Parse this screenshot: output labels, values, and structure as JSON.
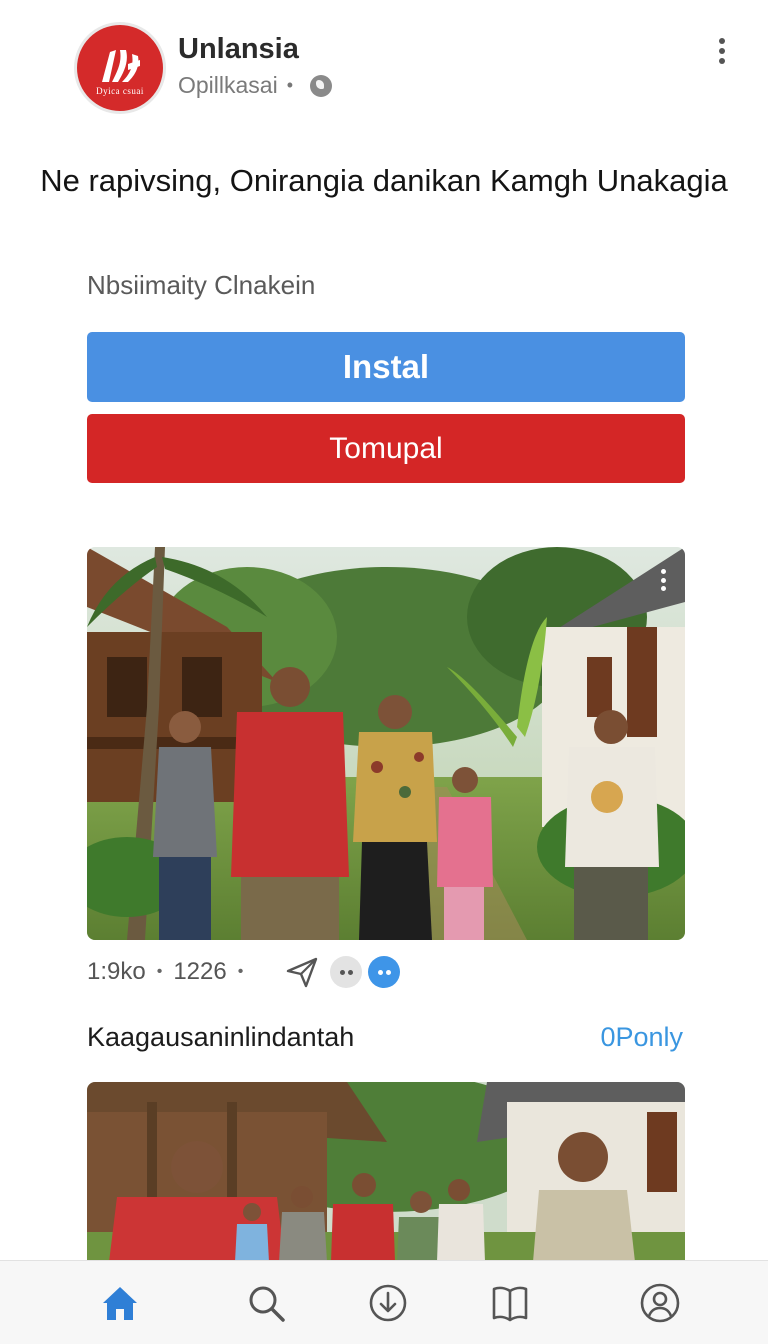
{
  "app": {
    "name": "Unlansia",
    "subtitle": "Opillkasai",
    "logo_text": "Dyica csuai"
  },
  "headline": "Ne rapivsing, Onirangia danikan Kamgh Unakagia",
  "category": "Nbsiimaity Clnakein",
  "buttons": {
    "install": "Instal",
    "secondary": "Tomupal"
  },
  "stats": {
    "views": "1:9ko",
    "count": "1226"
  },
  "section": {
    "title": "Kaagausaninlindantah",
    "link": "0Ponly"
  },
  "colors": {
    "install_button": "#4a90e2",
    "secondary_button": "#d42626",
    "brand": "#d42a2a",
    "link": "#3a96e0",
    "nav_active": "#2f7fd6"
  },
  "nav": {
    "items": [
      "home-icon",
      "search-icon",
      "download-icon",
      "library-icon",
      "profile-icon"
    ],
    "active": "home-icon"
  }
}
